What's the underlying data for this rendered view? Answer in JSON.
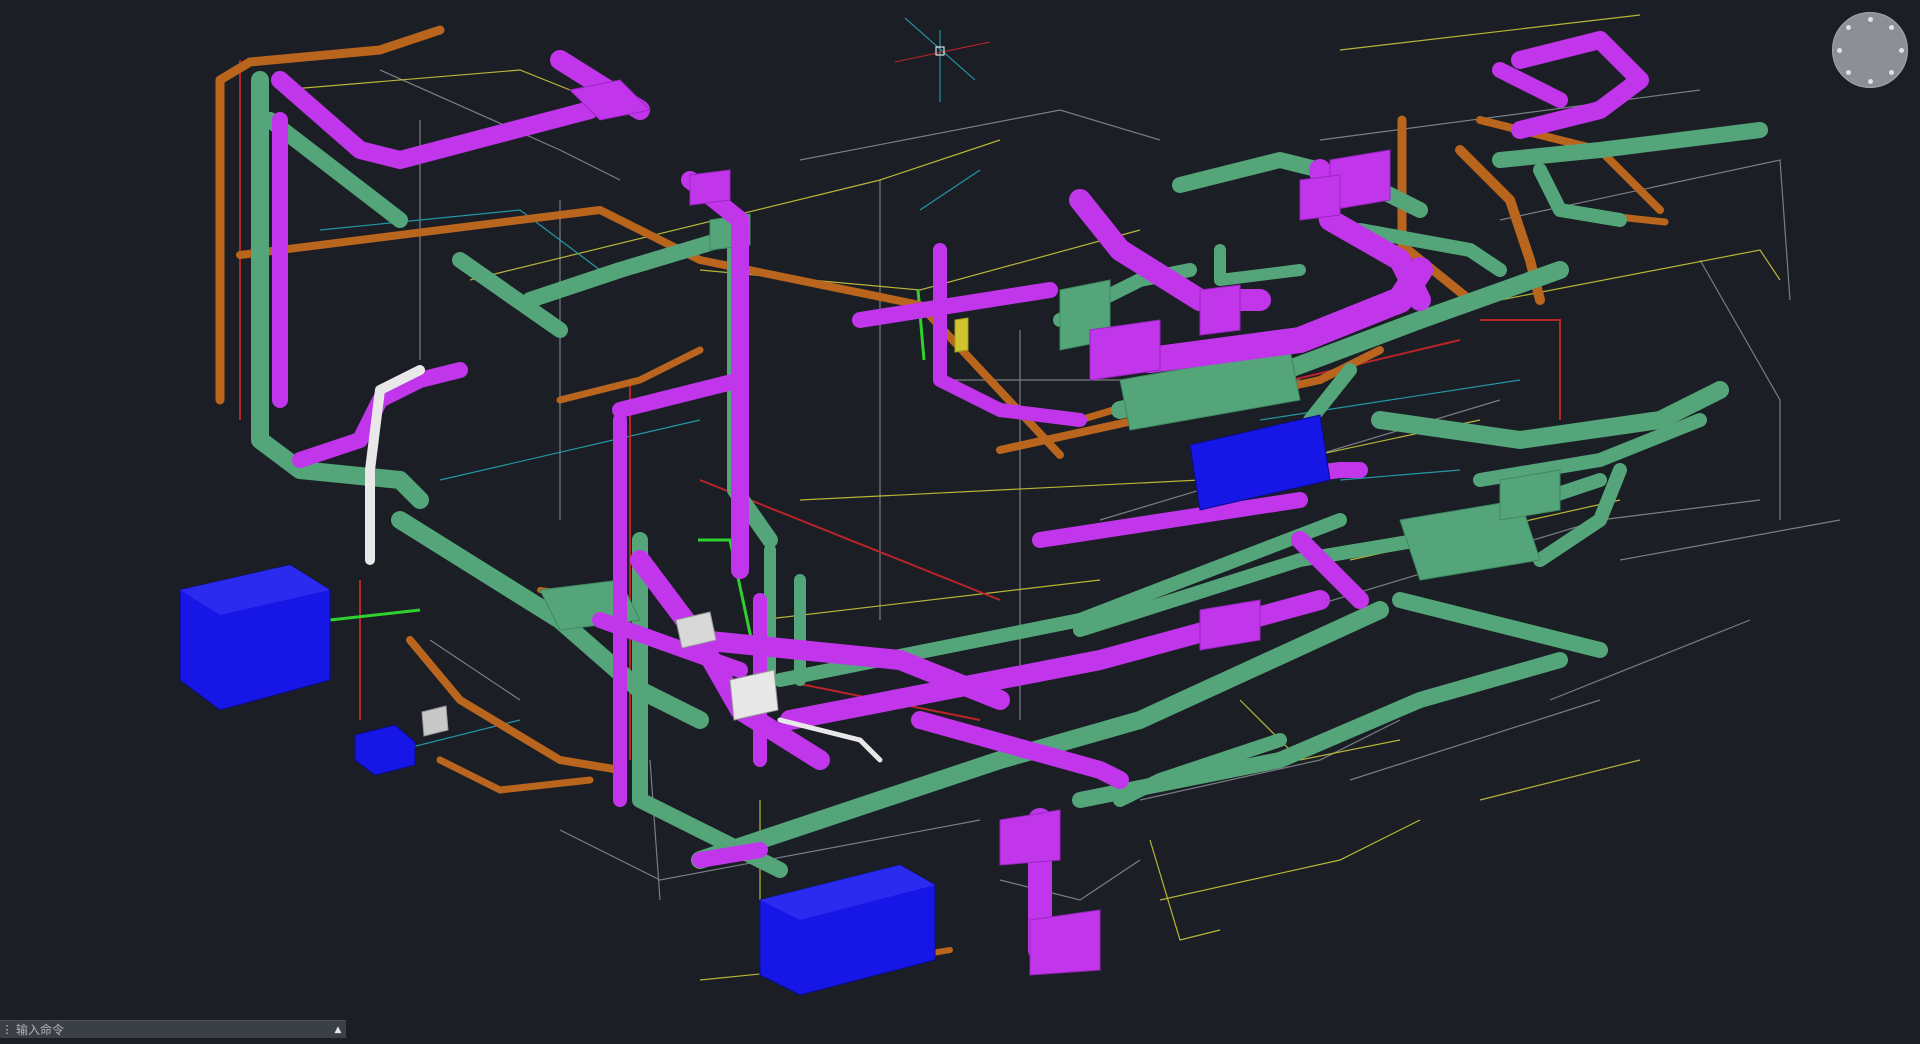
{
  "viewport": {
    "background": "#1b1e24"
  },
  "palette": {
    "green_duct": "#54a57a",
    "magenta_duct": "#c136ea",
    "orange_pipe": "#b9651e",
    "blue_equipment": "#1616e6",
    "white_pipe": "#e8e8e8",
    "red_line": "#c0262a",
    "yellow_line": "#c9c63a",
    "cyan_line": "#23a5b4",
    "grey_line": "#8a8f96",
    "bright_green": "#2ed12e"
  },
  "nav": {
    "icon": "navigation-wheel-icon"
  },
  "command_line": {
    "placeholder": "输入命令",
    "grip_icon": "grip-icon",
    "toggle_icon": "chevron-up-icon",
    "toggle_glyph": "▲"
  }
}
